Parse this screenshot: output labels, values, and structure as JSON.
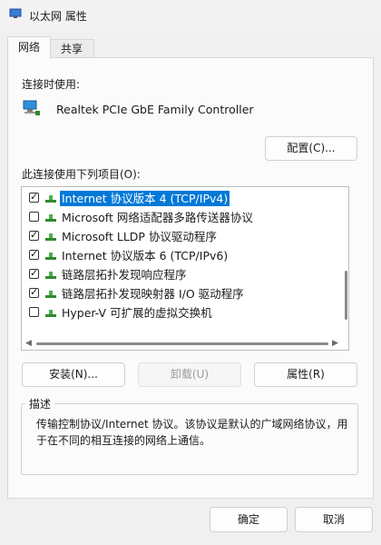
{
  "window": {
    "title": "以太网 属性",
    "icon": "network-adapter-icon"
  },
  "tabs": [
    {
      "label": "网络",
      "active": true
    },
    {
      "label": "共享",
      "active": false
    }
  ],
  "connect_using": {
    "label": "连接时使用:",
    "adapter_name": "Realtek PCIe GbE Family Controller",
    "configure_button": "配置(C)..."
  },
  "items_section": {
    "label": "此连接使用下列项目(O):",
    "items": [
      {
        "label": "Internet 协议版本 4 (TCP/IPv4)",
        "checked": true,
        "selected": true
      },
      {
        "label": "Microsoft 网络适配器多路传送器协议",
        "checked": false,
        "selected": false
      },
      {
        "label": "Microsoft LLDP 协议驱动程序",
        "checked": true,
        "selected": false
      },
      {
        "label": "Internet 协议版本 6 (TCP/IPv6)",
        "checked": true,
        "selected": false
      },
      {
        "label": "链路层拓扑发现响应程序",
        "checked": true,
        "selected": false
      },
      {
        "label": "链路层拓扑发现映射器 I/O 驱动程序",
        "checked": true,
        "selected": false
      },
      {
        "label": "Hyper-V 可扩展的虚拟交换机",
        "checked": false,
        "selected": false
      }
    ]
  },
  "action_buttons": {
    "install": "安装(N)...",
    "uninstall": "卸载(U)",
    "properties": "属性(R)"
  },
  "description": {
    "title": "描述",
    "text": "传输控制协议/Internet 协议。该协议是默认的广域网络协议，用于在不同的相互连接的网络上通信。"
  },
  "footer": {
    "ok": "确定",
    "cancel": "取消"
  },
  "colors": {
    "selection": "#0078d7",
    "icon_green": "#2e8b2e"
  }
}
